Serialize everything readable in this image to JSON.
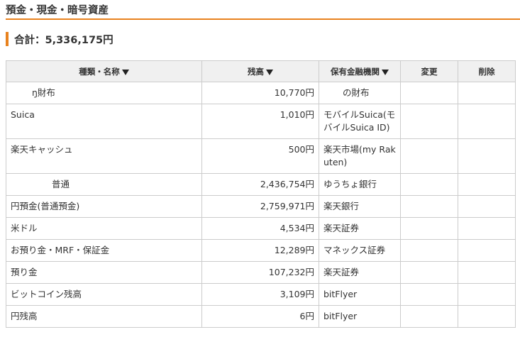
{
  "section": {
    "title": "預金・現金・暗号資産"
  },
  "total": {
    "text": "合計：5,336,175円"
  },
  "table": {
    "headers": {
      "name": "種類・名称",
      "balance": "残高",
      "institution": "保有金融機関",
      "edit": "変更",
      "delete": "削除"
    },
    "rows": [
      {
        "name": "ŋ財布",
        "balance": "10,770円",
        "institution": "の財布"
      },
      {
        "name": "Suica",
        "balance": "1,010円",
        "institution": "モバイルSuica(モバイルSuica ID)"
      },
      {
        "name": "楽天キャッシュ",
        "balance": "500円",
        "institution": "楽天市場(my Rakuten)"
      },
      {
        "name": "普通",
        "balance": "2,436,754円",
        "institution": "ゆうちょ銀行"
      },
      {
        "name": "円預金(普通預金)",
        "balance": "2,759,971円",
        "institution": "楽天銀行"
      },
      {
        "name": "米ドル",
        "balance": "4,534円",
        "institution": "楽天証券"
      },
      {
        "name": "お預り金・MRF・保証金",
        "balance": "12,289円",
        "institution": "マネックス証券"
      },
      {
        "name": "預り金",
        "balance": "107,232円",
        "institution": "楽天証券"
      },
      {
        "name": "ビットコイン残高",
        "balance": "3,109円",
        "institution": "bitFlyer"
      },
      {
        "name": "円残高",
        "balance": "6円",
        "institution": "bitFlyer"
      }
    ]
  }
}
